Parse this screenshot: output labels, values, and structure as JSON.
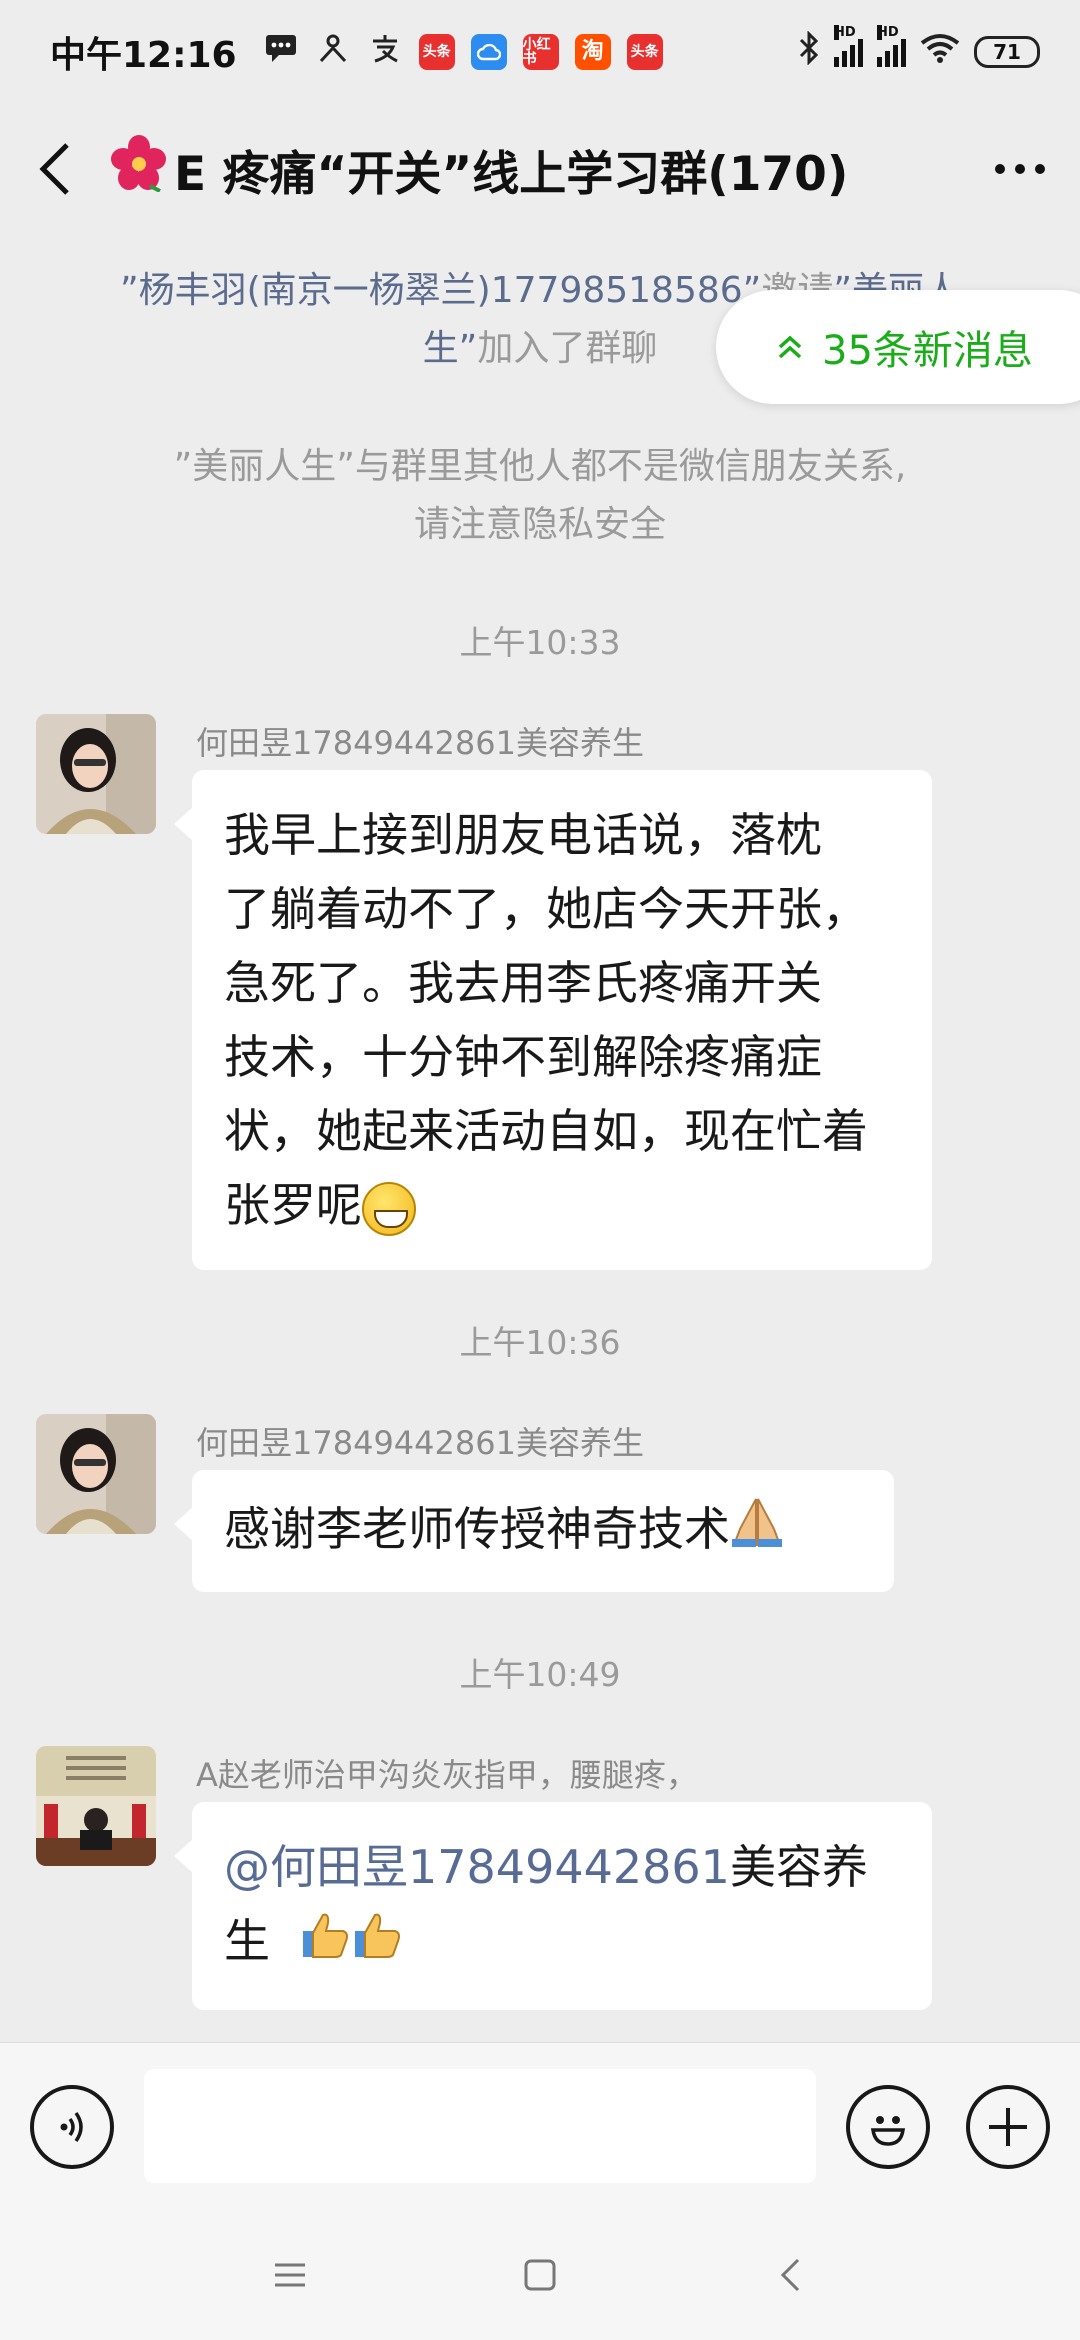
{
  "status_bar": {
    "time": "中午12:16",
    "app_badges": [
      {
        "label": "头条",
        "color": "#e8312f"
      },
      {
        "label": "",
        "color": "#2d8cf0"
      },
      {
        "label": "小红书",
        "color": "#e8312f"
      },
      {
        "label": "淘",
        "color": "#ff5000"
      },
      {
        "label": "头条",
        "color": "#e8312f"
      }
    ],
    "battery": "71"
  },
  "header": {
    "title": "E 疼痛“开关”线上学习群(170)"
  },
  "notices": {
    "invite_highlight_1": "”杨丰羽(南京一杨翠兰)17798518586”",
    "invite_text": "邀请",
    "invite_highlight_2": "”美丽人生”",
    "invite_suffix": "加入了群聊",
    "privacy_line1": "”美丽人生”与群里其他人都不是微信朋友关系,",
    "privacy_line2": "请注意隐私安全",
    "new_messages": "35条新消息"
  },
  "messages": [
    {
      "time": "上午10:33",
      "sender": "何田昱17849442861美容养生",
      "lines": [
        "我早上接到朋友电话说，落枕",
        "了躺着动不了，她店今天开张，",
        "急死了。我去用李氏疼痛开关",
        "技术，十分钟不到解除疼痛症",
        "状，她起来活动自如，现在忙着",
        "张罗呢"
      ]
    },
    {
      "time": "上午10:36",
      "sender": "何田昱17849442861美容养生",
      "text": "感谢李老师传授神奇技术"
    },
    {
      "time": "上午10:49",
      "sender": "A赵老师治甲沟炎灰指甲，腰腿疼，",
      "mention_at": "@何田昱",
      "mention_number": "17849442861",
      "mention_rest": "美容养",
      "line2": "生"
    }
  ],
  "colors": {
    "background": "#ededed",
    "bubble": "#ffffff",
    "accent_green": "#1aad19",
    "link_blue": "#576b95"
  }
}
